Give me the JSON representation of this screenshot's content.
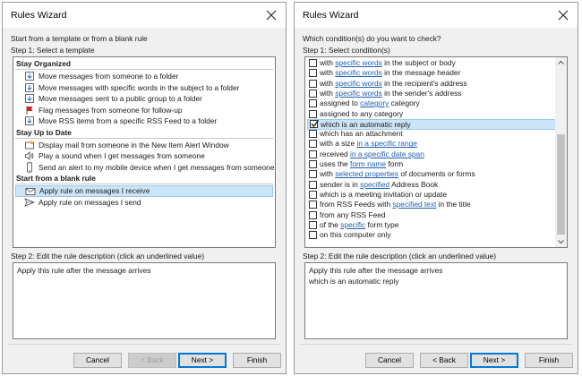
{
  "left": {
    "title": "Rules Wizard",
    "prompt": "Start from a template or from a blank rule",
    "step1": "Step 1: Select a template",
    "groups": [
      {
        "header": "Stay Organized",
        "items": [
          {
            "label": "Move messages from someone to a folder",
            "icon": "move-to-folder-icon"
          },
          {
            "label": "Move messages with specific words in the subject to a folder",
            "icon": "move-to-folder-icon"
          },
          {
            "label": "Move messages sent to a public group to a folder",
            "icon": "move-to-folder-icon"
          },
          {
            "label": "Flag messages from someone for follow-up",
            "icon": "flag-icon"
          },
          {
            "label": "Move RSS items from a specific RSS Feed to a folder",
            "icon": "move-to-folder-icon"
          }
        ]
      },
      {
        "header": "Stay Up to Date",
        "items": [
          {
            "label": "Display mail from someone in the New Item Alert Window",
            "icon": "new-item-alert-icon"
          },
          {
            "label": "Play a sound when I get messages from someone",
            "icon": "speaker-icon"
          },
          {
            "label": "Send an alert to my mobile device when I get messages from someone",
            "icon": "mobile-device-icon"
          }
        ]
      },
      {
        "header": "Start from a blank rule",
        "items": [
          {
            "label": "Apply rule on messages I receive",
            "icon": "envelope-icon",
            "selected": true
          },
          {
            "label": "Apply rule on messages I send",
            "icon": "send-icon"
          }
        ]
      }
    ],
    "step2": "Step 2: Edit the rule description (click an underlined value)",
    "description": [
      "Apply this rule after the message arrives"
    ],
    "buttons": {
      "cancel": "Cancel",
      "back": "< Back",
      "next": "Next >",
      "finish": "Finish"
    }
  },
  "right": {
    "title": "Rules Wizard",
    "prompt": "Which condition(s) do you want to check?",
    "step1": "Step 1: Select condition(s)",
    "conditions": [
      {
        "parts": [
          {
            "t": "with "
          },
          {
            "t": "specific words",
            "link": true
          },
          {
            "t": " in the subject or body"
          }
        ],
        "checked": false
      },
      {
        "parts": [
          {
            "t": "with "
          },
          {
            "t": "specific words",
            "link": true
          },
          {
            "t": " in the message header"
          }
        ],
        "checked": false
      },
      {
        "parts": [
          {
            "t": "with "
          },
          {
            "t": "specific words",
            "link": true
          },
          {
            "t": " in the recipient's address"
          }
        ],
        "checked": false
      },
      {
        "parts": [
          {
            "t": "with "
          },
          {
            "t": "specific words",
            "link": true
          },
          {
            "t": " in the sender's address"
          }
        ],
        "checked": false
      },
      {
        "parts": [
          {
            "t": "assigned to "
          },
          {
            "t": "category",
            "link": true
          },
          {
            "t": " category"
          }
        ],
        "checked": false
      },
      {
        "parts": [
          {
            "t": "assigned to any category"
          }
        ],
        "checked": false
      },
      {
        "parts": [
          {
            "t": "which is an automatic reply"
          }
        ],
        "checked": true,
        "selected": true
      },
      {
        "parts": [
          {
            "t": "which has an attachment"
          }
        ],
        "checked": false
      },
      {
        "parts": [
          {
            "t": "with a size "
          },
          {
            "t": "in a specific range",
            "link": true
          }
        ],
        "checked": false
      },
      {
        "parts": [
          {
            "t": "received "
          },
          {
            "t": "in a specific date span",
            "link": true
          }
        ],
        "checked": false
      },
      {
        "parts": [
          {
            "t": "uses the "
          },
          {
            "t": "form name",
            "link": true
          },
          {
            "t": " form"
          }
        ],
        "checked": false
      },
      {
        "parts": [
          {
            "t": "with "
          },
          {
            "t": "selected properties",
            "link": true
          },
          {
            "t": " of documents or forms"
          }
        ],
        "checked": false
      },
      {
        "parts": [
          {
            "t": "sender is in "
          },
          {
            "t": "specified",
            "link": true
          },
          {
            "t": " Address Book"
          }
        ],
        "checked": false
      },
      {
        "parts": [
          {
            "t": "which is a meeting invitation or update"
          }
        ],
        "checked": false
      },
      {
        "parts": [
          {
            "t": "from RSS Feeds with "
          },
          {
            "t": "specified text",
            "link": true
          },
          {
            "t": " in the title"
          }
        ],
        "checked": false
      },
      {
        "parts": [
          {
            "t": "from any RSS Feed"
          }
        ],
        "checked": false
      },
      {
        "parts": [
          {
            "t": "of the "
          },
          {
            "t": "specific",
            "link": true
          },
          {
            "t": " form type"
          }
        ],
        "checked": false
      },
      {
        "parts": [
          {
            "t": "on this computer only"
          }
        ],
        "checked": false
      }
    ],
    "step2": "Step 2: Edit the rule description (click an underlined value)",
    "description": [
      "Apply this rule after the message arrives",
      "which is an automatic reply"
    ],
    "buttons": {
      "cancel": "Cancel",
      "back": "< Back",
      "next": "Next >",
      "finish": "Finish"
    }
  },
  "colors": {
    "selection": "#cce4f7",
    "selection_border": "#99c9ef",
    "link": "#1e5fb4",
    "primary_border": "#0078d7"
  }
}
